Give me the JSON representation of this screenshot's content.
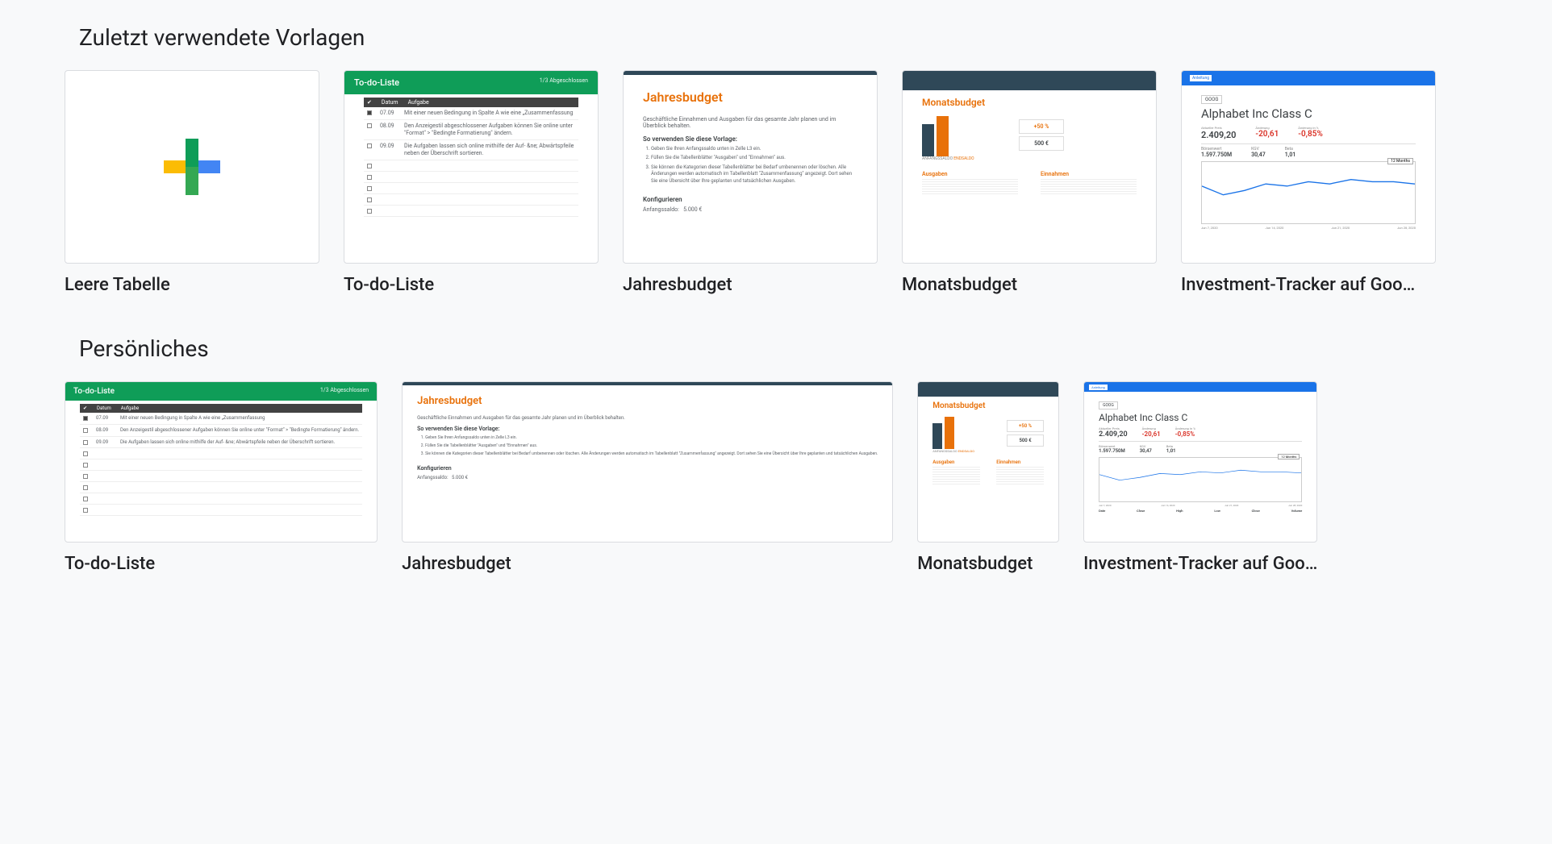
{
  "sections": {
    "recent": {
      "title": "Zuletzt verwendete Vorlagen",
      "templates": [
        {
          "id": "blank",
          "title": "Leere Tabelle"
        },
        {
          "id": "todo",
          "title": "To-do-Liste"
        },
        {
          "id": "annual",
          "title": "Jahresbudget"
        },
        {
          "id": "monthly",
          "title": "Monatsbudget"
        },
        {
          "id": "invest",
          "title": "Investment-Tracker auf Goo…"
        }
      ]
    },
    "personal": {
      "title": "Persönliches",
      "templates": [
        {
          "id": "todo",
          "title": "To-do-Liste"
        },
        {
          "id": "annual",
          "title": "Jahresbudget"
        },
        {
          "id": "monthly",
          "title": "Monatsbudget"
        },
        {
          "id": "invest",
          "title": "Investment-Tracker auf Goo…"
        }
      ]
    }
  },
  "previews": {
    "todo": {
      "header_title": "To-do-Liste",
      "header_sub": "1/3 Abgeschlossen",
      "col_check": "✔",
      "col_date": "Datum",
      "col_task": "Aufgabe",
      "rows": [
        {
          "checked": true,
          "date": "07.09",
          "text": "Mit einer neuen Bedingung in Spalte A wie eine „Zusammenfassung"
        },
        {
          "checked": false,
          "date": "08.09",
          "text": "Den Anzeigestil abgeschlossener Aufgaben können Sie online unter \"Format\" > \"Bedingte Formatierung\" ändern."
        },
        {
          "checked": false,
          "date": "09.09",
          "text": "Die Aufgaben lassen sich online mithilfe der Auf- &ne; Abwärtspfeile neben der Überschrift sortieren."
        }
      ]
    },
    "annual": {
      "title": "Jahresbudget",
      "subtitle": "Geschäftliche Einnahmen und Ausgaben für das gesamte Jahr planen und im Überblick behalten.",
      "instr_head": "So verwenden Sie diese Vorlage:",
      "instr": [
        "Geben Sie Ihren Anfangssaldo unten in Zelle L3 ein.",
        "Füllen Sie die Tabellenblätter \"Ausgaben\" und \"Einnahmen\" aus.",
        "Sie können die Kategorien dieser Tabellenblätter bei Bedarf umbenennen oder löschen. Alle Änderungen werden automatisch im Tabellenblatt \"Zusammenfassung\" angezeigt. Dort sehen Sie eine Übersicht über Ihre geplanten und tatsächlichen Ausgaben."
      ],
      "config_head": "Konfigurieren",
      "config_label": "Anfangssaldo:",
      "config_value": "5.000 €"
    },
    "monthly": {
      "title": "Monatsbudget",
      "bar_label1": "ANFANGSSALDO",
      "bar_label2": "ENDSALDO",
      "pct": "+50 %",
      "amt": "500 €",
      "tab1": "Ausgaben",
      "tab2": "Einnahmen"
    },
    "invest": {
      "bar_label": "Anleitung",
      "ticker": "GOOG",
      "name": "Alphabet Inc Class C",
      "price_label": "Aktueller Preis",
      "price_value": "2.409,20",
      "change_label": "Änderung",
      "change_value": "-20,61",
      "change_pct_label": "Änderung in %",
      "change_pct_value": "-0,85%",
      "stat1_label": "Börsenwert",
      "stat1_value": "1.597.750M",
      "stat2_label": "KGV",
      "stat2_value": "30,47",
      "stat3_label": "Beta",
      "stat3_value": "1,01",
      "months": "12 Months",
      "xlabels": [
        "Jun 7, 2020",
        "Jun 14, 2020",
        "Jun 21, 2020",
        "Jun 28, 2020"
      ],
      "cols": [
        "Date",
        "Close",
        "High",
        "Low",
        "Close",
        "Volume"
      ]
    }
  }
}
